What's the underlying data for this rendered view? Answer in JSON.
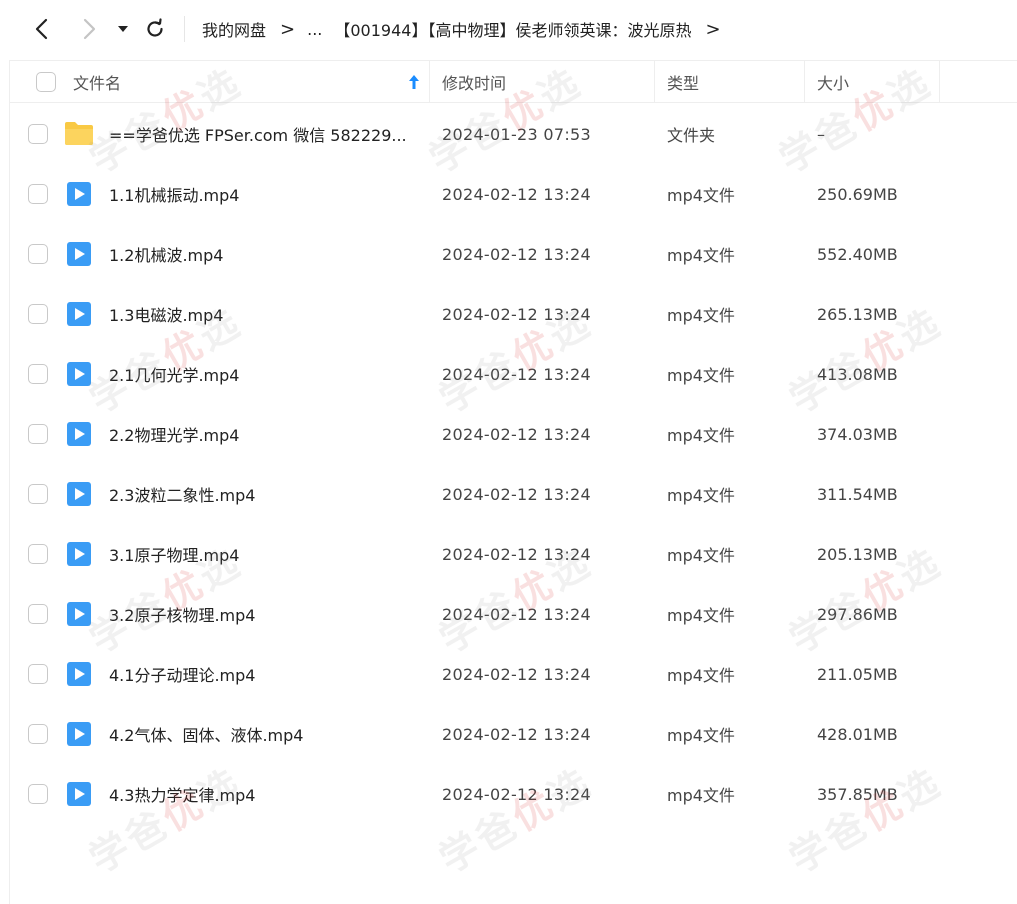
{
  "nav": {
    "back_icon": "chevron-left-icon",
    "forward_icon": "chevron-right-icon",
    "dropdown_icon": "caret-down-icon",
    "refresh_icon": "refresh-icon"
  },
  "breadcrumb": {
    "root": "我的网盘",
    "ellipsis": "...",
    "current": "【001944】【高中物理】侯老师领英课：波光原热",
    "separator": ">"
  },
  "table": {
    "columns": {
      "name": "文件名",
      "modified": "修改时间",
      "type": "类型",
      "size": "大小"
    },
    "sort_icon": "sort-arrow-up-icon",
    "rows": [
      {
        "name": "==学爸优选 FPSer.com 微信 582229...",
        "modified": "2024-01-23 07:53",
        "type": "文件夹",
        "size": "–",
        "icon": "folder-icon"
      },
      {
        "name": "1.1机械振动.mp4",
        "modified": "2024-02-12 13:24",
        "type": "mp4文件",
        "size": "250.69MB",
        "icon": "video-file-icon"
      },
      {
        "name": "1.2机械波.mp4",
        "modified": "2024-02-12 13:24",
        "type": "mp4文件",
        "size": "552.40MB",
        "icon": "video-file-icon"
      },
      {
        "name": "1.3电磁波.mp4",
        "modified": "2024-02-12 13:24",
        "type": "mp4文件",
        "size": "265.13MB",
        "icon": "video-file-icon"
      },
      {
        "name": "2.1几何光学.mp4",
        "modified": "2024-02-12 13:24",
        "type": "mp4文件",
        "size": "413.08MB",
        "icon": "video-file-icon"
      },
      {
        "name": "2.2物理光学.mp4",
        "modified": "2024-02-12 13:24",
        "type": "mp4文件",
        "size": "374.03MB",
        "icon": "video-file-icon"
      },
      {
        "name": "2.3波粒二象性.mp4",
        "modified": "2024-02-12 13:24",
        "type": "mp4文件",
        "size": "311.54MB",
        "icon": "video-file-icon"
      },
      {
        "name": "3.1原子物理.mp4",
        "modified": "2024-02-12 13:24",
        "type": "mp4文件",
        "size": "205.13MB",
        "icon": "video-file-icon"
      },
      {
        "name": "3.2原子核物理.mp4",
        "modified": "2024-02-12 13:24",
        "type": "mp4文件",
        "size": "297.86MB",
        "icon": "video-file-icon"
      },
      {
        "name": "4.1分子动理论.mp4",
        "modified": "2024-02-12 13:24",
        "type": "mp4文件",
        "size": "211.05MB",
        "icon": "video-file-icon"
      },
      {
        "name": "4.2气体、固体、液体.mp4",
        "modified": "2024-02-12 13:24",
        "type": "mp4文件",
        "size": "428.01MB",
        "icon": "video-file-icon"
      },
      {
        "name": "4.3热力学定律.mp4",
        "modified": "2024-02-12 13:24",
        "type": "mp4文件",
        "size": "357.85MB",
        "icon": "video-file-icon"
      }
    ]
  },
  "watermark": {
    "text_a": "学爸",
    "text_b": "优",
    "text_c": "选"
  },
  "colors": {
    "accent": "#1a8cff",
    "folder": "#f9c944",
    "video": "#3a9cf5"
  }
}
